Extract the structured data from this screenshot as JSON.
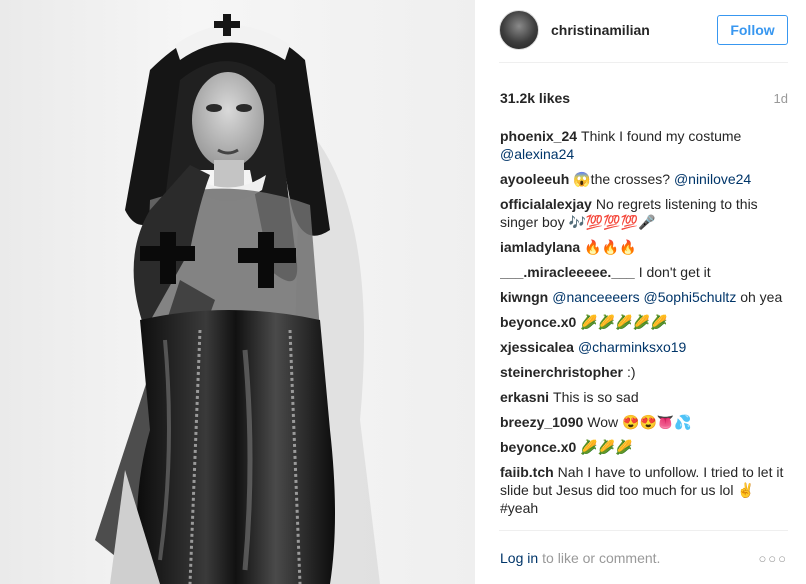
{
  "post": {
    "username": "christinamilian",
    "follow_label": "Follow",
    "likes": "31.2k likes",
    "age": "1d"
  },
  "comments": [
    {
      "user": "phoenix_24",
      "text": "Think I found my costume",
      "mention": "@alexina24"
    },
    {
      "user": "ayooleeuh",
      "text": "😱the crosses?",
      "mention": "@ninilove24"
    },
    {
      "user": "officialalexjay",
      "text": "No regrets listening to this singer boy 🎶💯💯💯🎤",
      "mention": ""
    },
    {
      "user": "iamladylana",
      "text": "🔥🔥🔥",
      "mention": ""
    },
    {
      "user": "___.miracleeeee.___",
      "text": "I don't get it",
      "mention": ""
    },
    {
      "user": "kiwngn",
      "text": "",
      "mention": "@nanceeeers @5ophi5chultz",
      "suffix": "oh yea"
    },
    {
      "user": "beyonce.x0",
      "text": "🌽🌽🌽🌽🌽",
      "mention": ""
    },
    {
      "user": "xjessicalea",
      "text": "",
      "mention": "@charminksxo19"
    },
    {
      "user": "steinerchristopher",
      "text": ":)",
      "mention": ""
    },
    {
      "user": "erkasni",
      "text": "This is so sad",
      "mention": ""
    },
    {
      "user": "breezy_1090",
      "text": "Wow 😍😍👅💦",
      "mention": ""
    },
    {
      "user": "beyonce.x0",
      "text": "🌽🌽🌽",
      "mention": ""
    },
    {
      "user": "faiib.tch",
      "text": "Nah I have to unfollow. I tried to let it slide but Jesus did too much for us lol ✌️ #yeah",
      "mention": ""
    }
  ],
  "footer": {
    "login_label": "Log in",
    "prompt": "to like or comment.",
    "more_label": "○○○"
  },
  "colors": {
    "accent": "#3897f0",
    "link": "#003569",
    "muted": "#999999"
  },
  "icons": [
    "more-options-icon"
  ]
}
